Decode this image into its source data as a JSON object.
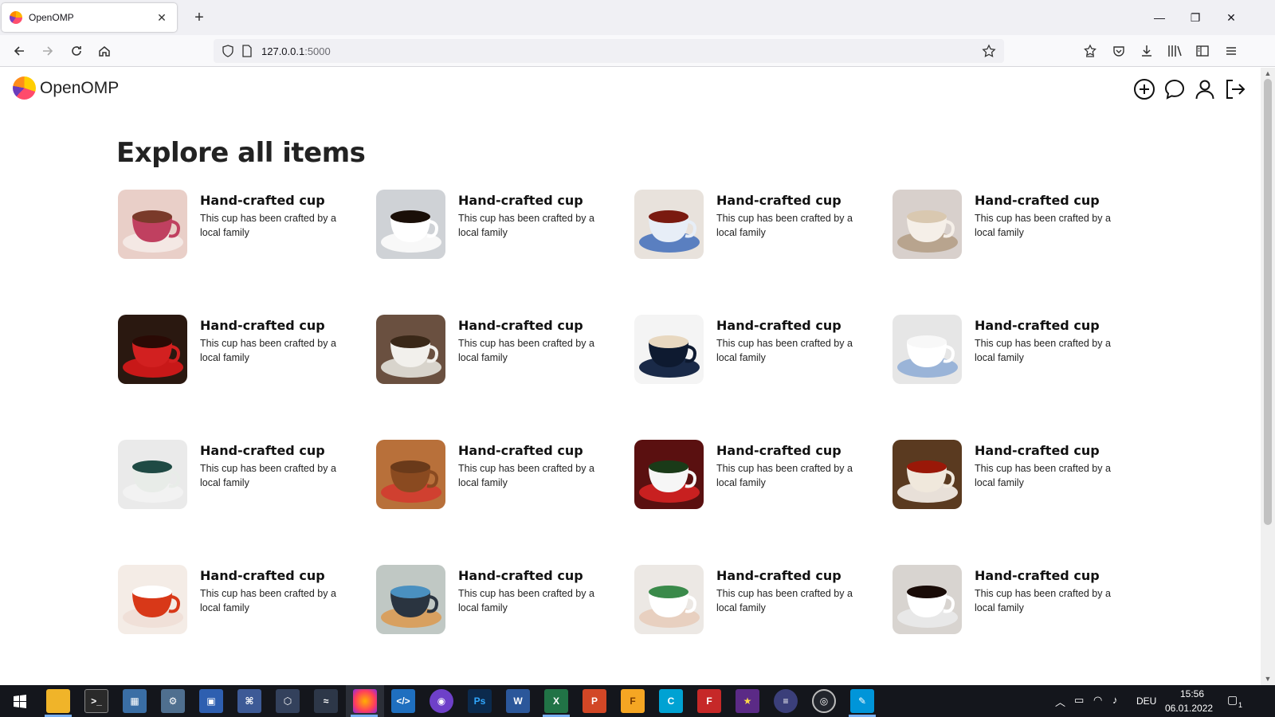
{
  "browser": {
    "tab_title": "OpenOMP",
    "url_host": "127.0.0.1",
    "url_port": ":5000"
  },
  "site": {
    "brand": "OpenOMP",
    "header_icons": [
      "add-circle-icon",
      "chat-bubble-icon",
      "user-icon",
      "logout-icon"
    ]
  },
  "main": {
    "title": "Explore all items",
    "items": [
      {
        "title": "Hand-crafted cup",
        "description": "This cup has been crafted by a local family"
      },
      {
        "title": "Hand-crafted cup",
        "description": "This cup has been crafted by a local family"
      },
      {
        "title": "Hand-crafted cup",
        "description": "This cup has been crafted by a local family"
      },
      {
        "title": "Hand-crafted cup",
        "description": "This cup has been crafted by a local family"
      },
      {
        "title": "Hand-crafted cup",
        "description": "This cup has been crafted by a local family"
      },
      {
        "title": "Hand-crafted cup",
        "description": "This cup has been crafted by a local family"
      },
      {
        "title": "Hand-crafted cup",
        "description": "This cup has been crafted by a local family"
      },
      {
        "title": "Hand-crafted cup",
        "description": "This cup has been crafted by a local family"
      },
      {
        "title": "Hand-crafted cup",
        "description": "This cup has been crafted by a local family"
      },
      {
        "title": "Hand-crafted cup",
        "description": "This cup has been crafted by a local family"
      },
      {
        "title": "Hand-crafted cup",
        "description": "This cup has been crafted by a local family"
      },
      {
        "title": "Hand-crafted cup",
        "description": "This cup has been crafted by a local family"
      },
      {
        "title": "Hand-crafted cup",
        "description": "This cup has been crafted by a local family"
      },
      {
        "title": "Hand-crafted cup",
        "description": "This cup has been crafted by a local family"
      },
      {
        "title": "Hand-crafted cup",
        "description": "This cup has been crafted by a local family"
      },
      {
        "title": "Hand-crafted cup",
        "description": "This cup has been crafted by a local family"
      }
    ]
  },
  "taskbar": {
    "language": "DEU",
    "time": "15:56",
    "date": "06.01.2022",
    "notification_count": "1"
  },
  "colors": {
    "tab_strip": "#f0f0f4",
    "taskbar": "#14161c",
    "active_underline": "#78aef0"
  }
}
